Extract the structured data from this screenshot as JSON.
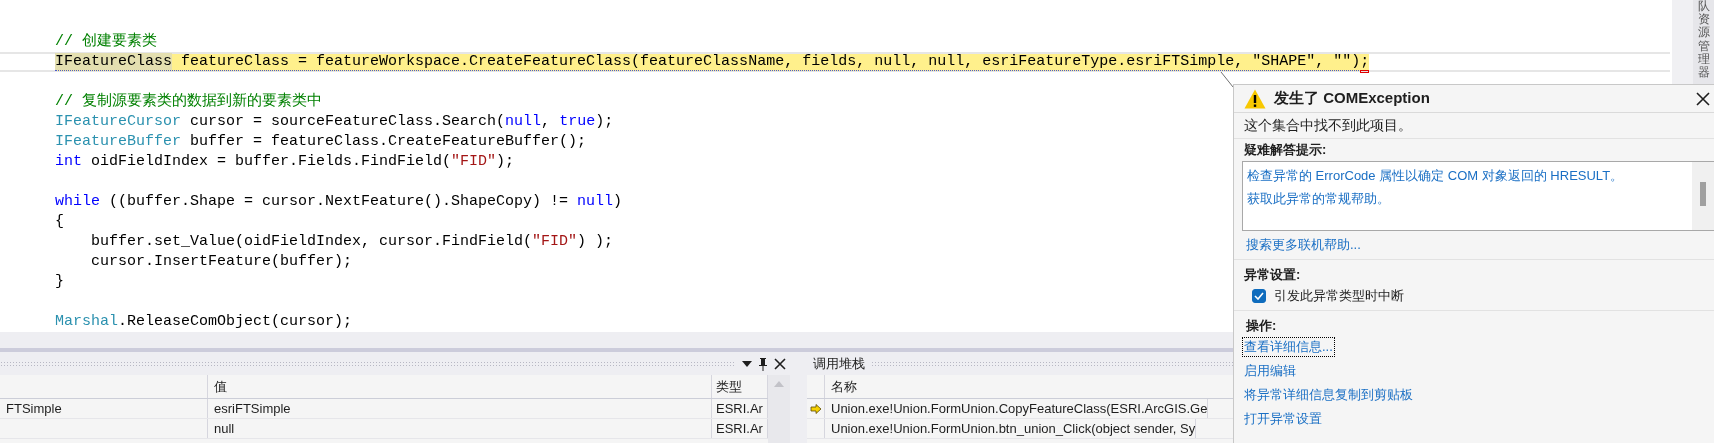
{
  "editor": {
    "lines": [
      {
        "kind": "code",
        "current": false,
        "tokens": [
          {
            "text": "// 创建要素类",
            "kind": "comment"
          }
        ]
      },
      {
        "kind": "code",
        "current": true,
        "tokens": [
          {
            "text": "IFeatureClass",
            "kind": "symbol"
          },
          {
            "text": " featureClass = featureWorkspace.CreateFeatureClass(featureClassName, fields, null, null, esriFeatureType.esriFTSimple, \"SHAPE\", \"\");",
            "kind": "plain"
          }
        ]
      },
      {
        "kind": "blank"
      },
      {
        "kind": "code",
        "current": false,
        "tokens": [
          {
            "text": "// 复制源要素类的数据到新的要素类中",
            "kind": "comment"
          }
        ]
      },
      {
        "kind": "code",
        "current": false,
        "tokens": [
          {
            "text": "IFeatureCursor",
            "kind": "type"
          },
          {
            "text": " cursor = sourceFeatureClass.Search(",
            "kind": "plain"
          },
          {
            "text": "null",
            "kind": "keyword"
          },
          {
            "text": ", ",
            "kind": "plain"
          },
          {
            "text": "true",
            "kind": "keyword"
          },
          {
            "text": ");",
            "kind": "plain"
          }
        ]
      },
      {
        "kind": "code",
        "current": false,
        "tokens": [
          {
            "text": "IFeatureBuffer",
            "kind": "type"
          },
          {
            "text": " buffer = featureClass.CreateFeatureBuffer();",
            "kind": "plain"
          }
        ]
      },
      {
        "kind": "code",
        "current": false,
        "tokens": [
          {
            "text": "int",
            "kind": "keyword"
          },
          {
            "text": " oidFieldIndex = buffer.Fields.FindField(",
            "kind": "plain"
          },
          {
            "text": "\"FID\"",
            "kind": "string"
          },
          {
            "text": ");",
            "kind": "plain"
          }
        ]
      },
      {
        "kind": "blank"
      },
      {
        "kind": "code",
        "current": false,
        "tokens": [
          {
            "text": "while",
            "kind": "keyword"
          },
          {
            "text": " ((buffer.Shape = cursor.NextFeature().ShapeCopy) != ",
            "kind": "plain"
          },
          {
            "text": "null",
            "kind": "keyword"
          },
          {
            "text": ")",
            "kind": "plain"
          }
        ]
      },
      {
        "kind": "code",
        "current": false,
        "tokens": [
          {
            "text": "{",
            "kind": "plain"
          }
        ]
      },
      {
        "kind": "code",
        "current": false,
        "tokens": [
          {
            "text": "    buffer.set_Value(oidFieldIndex, cursor.FindField(",
            "kind": "plain"
          },
          {
            "text": "\"FID\"",
            "kind": "string"
          },
          {
            "text": ") );",
            "kind": "plain"
          }
        ]
      },
      {
        "kind": "code",
        "current": false,
        "tokens": [
          {
            "text": "    cursor.InsertFeature(buffer);",
            "kind": "plain"
          }
        ]
      },
      {
        "kind": "code",
        "current": false,
        "tokens": [
          {
            "text": "}",
            "kind": "plain"
          }
        ]
      },
      {
        "kind": "blank"
      },
      {
        "kind": "code",
        "current": false,
        "tokens": [
          {
            "text": "Marshal",
            "kind": "type"
          },
          {
            "text": ".ReleaseComObject(cursor);",
            "kind": "plain"
          }
        ]
      }
    ]
  },
  "exception_popup": {
    "title": "发生了 COMException",
    "message": "这个集合中找不到此项目。",
    "troubleshooting": {
      "heading": "疑难解答提示:",
      "tips": [
        "检查异常的 ErrorCode 属性以确定 COM 对象返回的 HRESULT。",
        "获取此异常的常规帮助。"
      ]
    },
    "online_help_link": "搜索更多联机帮助...",
    "settings": {
      "heading": "异常设置:",
      "break_option": {
        "label": "引发此异常类型时中断",
        "checked": true
      }
    },
    "actions": {
      "heading": "操作:",
      "links": [
        {
          "label": "查看详细信息...",
          "focused": true
        },
        {
          "label": "启用编辑",
          "focused": false
        },
        {
          "label": "将异常详细信息复制到剪贴板",
          "focused": false
        },
        {
          "label": "打开异常设置",
          "focused": false
        }
      ]
    }
  },
  "autos_panel": {
    "columns": [
      "值",
      "类型"
    ],
    "rows": [
      {
        "name": "FTSimple",
        "value": "esriFTSimple",
        "type": "ESRI.Ar"
      },
      {
        "value": "null",
        "type": "ESRI.Ar"
      }
    ]
  },
  "call_stack": {
    "title": "调用堆栈",
    "column": "名称",
    "frames": [
      {
        "text": "Union.exe!Union.FormUnion.CopyFeatureClass(ESRI.ArcGIS.Ge",
        "current": true
      },
      {
        "text": "Union.exe!Union.FormUnion.btn_union_Click(object sender, Sy",
        "current": false
      }
    ]
  },
  "side_tab": {
    "label": "队资源管理器"
  }
}
